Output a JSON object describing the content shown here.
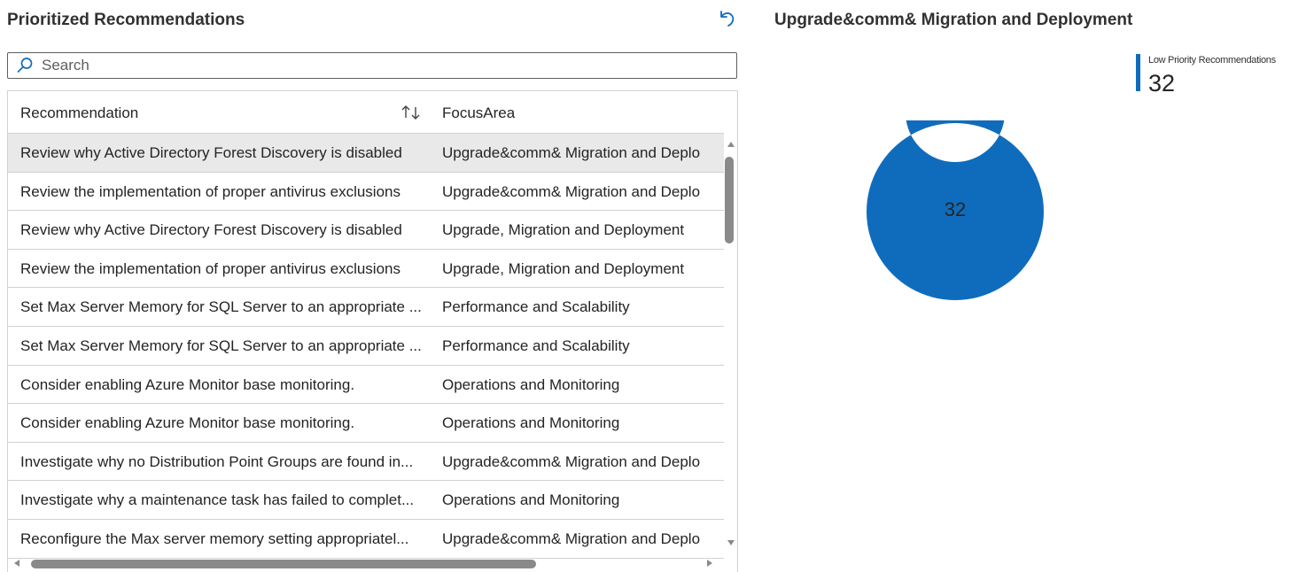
{
  "left_panel": {
    "title": "Prioritized Recommendations",
    "reset_icon": "undo-icon",
    "search": {
      "placeholder": "Search",
      "value": "",
      "icon": "search-icon"
    },
    "table": {
      "columns": [
        "Recommendation",
        "FocusArea"
      ],
      "sort_icon": "sort-arrows-icon",
      "rows": [
        {
          "recommendation": "Review why Active Directory Forest Discovery is disabled",
          "focus_area": "Upgrade&comm& Migration and Deplo",
          "selected": true
        },
        {
          "recommendation": "Review the implementation of proper antivirus exclusions",
          "focus_area": "Upgrade&comm& Migration and Deplo"
        },
        {
          "recommendation": "Review why Active Directory Forest Discovery is disabled",
          "focus_area": "Upgrade, Migration and Deployment"
        },
        {
          "recommendation": "Review the implementation of proper antivirus exclusions",
          "focus_area": "Upgrade, Migration and Deployment"
        },
        {
          "recommendation": "Set Max Server Memory for SQL Server to an appropriate ...",
          "focus_area": "Performance and Scalability"
        },
        {
          "recommendation": "Set Max Server Memory for SQL Server to an appropriate ...",
          "focus_area": "Performance and Scalability"
        },
        {
          "recommendation": "Consider enabling Azure Monitor base monitoring.",
          "focus_area": "Operations and Monitoring"
        },
        {
          "recommendation": "Consider enabling Azure Monitor base monitoring.",
          "focus_area": "Operations and Monitoring"
        },
        {
          "recommendation": "Investigate why no Distribution Point Groups are found in...",
          "focus_area": "Upgrade&comm& Migration and Deplo"
        },
        {
          "recommendation": "Investigate why a maintenance task has failed to complet...",
          "focus_area": "Operations and Monitoring"
        },
        {
          "recommendation": "Reconfigure the Max server memory setting appropriatel...",
          "focus_area": "Upgrade&comm& Migration and Deplo"
        }
      ]
    }
  },
  "right_panel": {
    "title": "Upgrade&comm& Migration and Deployment",
    "legend": {
      "label": "Low Priority Recommendations",
      "value": "32"
    },
    "donut_center": "32"
  },
  "chart_data": {
    "type": "pie",
    "categories": [
      "Low Priority Recommendations"
    ],
    "values": [
      32
    ],
    "center_label": "32",
    "colors": [
      "#0f6cbd"
    ],
    "legend_position": "top-right"
  },
  "colors": {
    "accent": "#0f6cbd",
    "selected_row": "#e9e9e9",
    "border": "#d1d1d1"
  }
}
